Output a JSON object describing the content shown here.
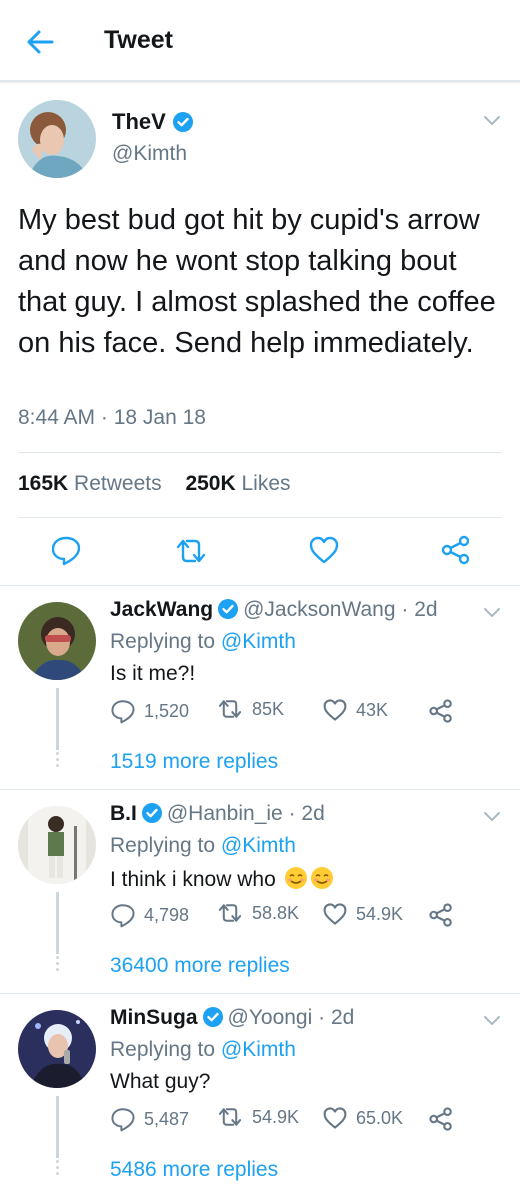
{
  "header": {
    "title": "Tweet"
  },
  "main_tweet": {
    "name": "TheV",
    "handle": "@Kimth",
    "text": "My best bud got hit by cupid's arrow and now he wont stop talking bout that guy. I almost splashed the coffee on his face. Send help immediately.",
    "meta": "8:44 AM · 18 Jan 18",
    "retweets_count": "165K",
    "retweets_label": "Retweets",
    "likes_count": "250K",
    "likes_label": "Likes"
  },
  "replies": [
    {
      "name": "JackWang",
      "handle": "@JacksonWang · 2d",
      "replying_label": "Replying to",
      "replying_to": "@Kimth",
      "text": "Is it me?!",
      "reply_count": "1,520",
      "retweet_count": "85K",
      "like_count": "43K",
      "more": "1519 more replies"
    },
    {
      "name": "B.I",
      "handle": "@Hanbin_ie · 2d",
      "replying_label": "Replying to",
      "replying_to": "@Kimth",
      "text": "I think i know who",
      "reply_count": "4,798",
      "retweet_count": "58.8K",
      "like_count": "54.9K",
      "more": "36400 more replies"
    },
    {
      "name": "MinSuga",
      "handle": "@Yoongi · 2d",
      "replying_label": "Replying to",
      "replying_to": "@Kimth",
      "text": "What guy?",
      "reply_count": "5,487",
      "retweet_count": "54.9K",
      "like_count": "65.0K",
      "more": "5486 more replies"
    }
  ],
  "colors": {
    "accent": "#1da1f2",
    "secondary_text": "#657786",
    "primary_text": "#14171a",
    "divider": "#e1e8ed"
  },
  "icons": [
    "back-arrow-icon",
    "verified-icon",
    "chevron-down-icon",
    "reply-icon",
    "retweet-icon",
    "like-icon",
    "share-icon",
    "smiling-emoji-icon"
  ]
}
